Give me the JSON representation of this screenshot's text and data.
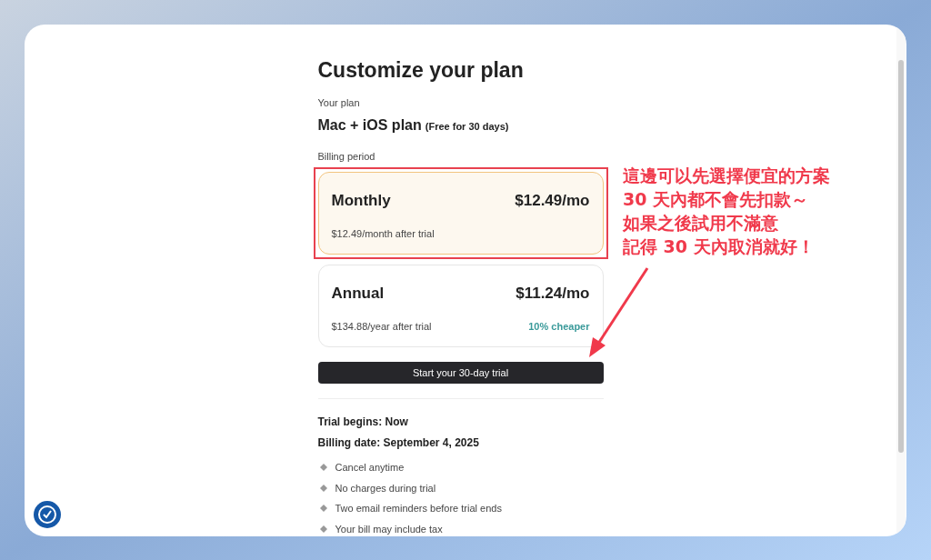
{
  "page": {
    "title": "Customize your plan",
    "plan_label": "Your plan",
    "plan_name": "Mac + iOS plan",
    "plan_note": "(Free for 30 days)",
    "billing_label": "Billing period"
  },
  "options": [
    {
      "name": "Monthly",
      "price": "$12.49/mo",
      "detail": "$12.49/month after trial",
      "selected": true
    },
    {
      "name": "Annual",
      "price": "$11.24/mo",
      "detail": "$134.88/year after trial",
      "badge": "10% cheaper",
      "selected": false
    }
  ],
  "cta": "Start your 30-day trial",
  "summary": [
    "Trial begins: Now",
    "Billing date: September 4, 2025"
  ],
  "bullets": [
    "Cancel anytime",
    "No charges during trial",
    "Two email reminders before trial ends",
    "Your bill may include tax"
  ],
  "annotation": [
    "這邊可以先選擇便宜的方案",
    "30 天內都不會先扣款～",
    "如果之後試用不滿意",
    "記得 30 天內取消就好！"
  ]
}
